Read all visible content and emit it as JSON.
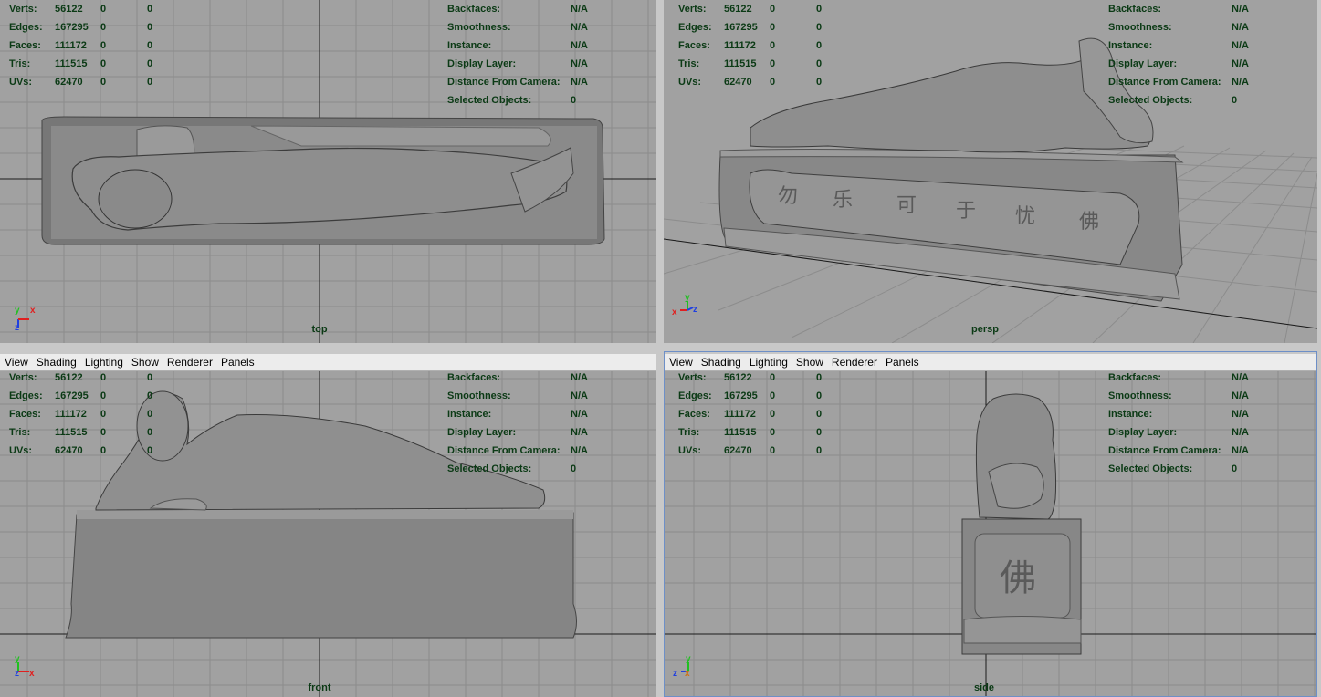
{
  "menu": [
    "View",
    "Shading",
    "Lighting",
    "Show",
    "Renderer",
    "Panels"
  ],
  "hud_left": [
    {
      "label": "Verts:",
      "v1": "56122",
      "v2": "0",
      "v3": "0"
    },
    {
      "label": "Edges:",
      "v1": "167295",
      "v2": "0",
      "v3": "0"
    },
    {
      "label": "Faces:",
      "v1": "111172",
      "v2": "0",
      "v3": "0"
    },
    {
      "label": "Tris:",
      "v1": "111515",
      "v2": "0",
      "v3": "0"
    },
    {
      "label": "UVs:",
      "v1": "62470",
      "v2": "0",
      "v3": "0"
    }
  ],
  "hud_right": [
    {
      "label": "Backfaces:",
      "value": "N/A"
    },
    {
      "label": "Smoothness:",
      "value": "N/A"
    },
    {
      "label": "Instance:",
      "value": "N/A"
    },
    {
      "label": "Display Layer:",
      "value": "N/A"
    },
    {
      "label": "Distance From Camera:",
      "value": "N/A"
    },
    {
      "label": "Selected Objects:",
      "value": "0"
    }
  ],
  "viewports": {
    "top": {
      "label": "top",
      "axis_up": "y",
      "axis_side": "x",
      "axis_depth": "z"
    },
    "persp": {
      "label": "persp",
      "axis_up": "y",
      "axis_side": "x",
      "axis_depth": "z"
    },
    "front": {
      "label": "front",
      "axis_up": "y",
      "axis_side": "x",
      "axis_depth": "z"
    },
    "side": {
      "label": "side",
      "axis_up": "y",
      "axis_side": "x",
      "axis_depth": "z"
    }
  },
  "icons": {
    "axis_gizmo": "axis-gizmo-icon"
  },
  "colors": {
    "viewport_bg": "#a1a1a1",
    "grid": "#8a8a8a",
    "hud_text": "#0b3a15",
    "axis_x": "#e02020",
    "axis_y": "#20c020",
    "axis_z": "#2040e0",
    "model": "#7a7a7a"
  }
}
